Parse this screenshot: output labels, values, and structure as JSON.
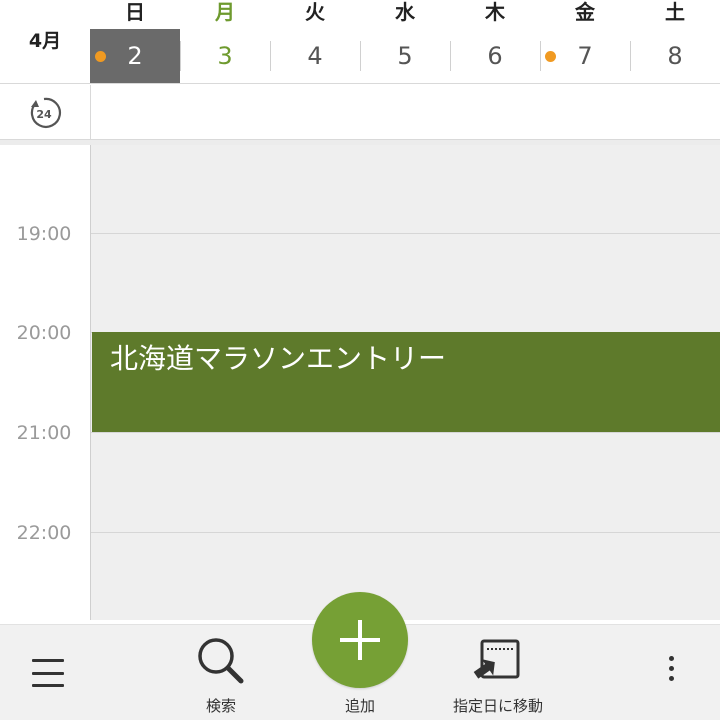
{
  "header": {
    "month": "4月",
    "weekdays": [
      "日",
      "月",
      "火",
      "水",
      "木",
      "金",
      "土"
    ],
    "dates": [
      "2",
      "3",
      "4",
      "5",
      "6",
      "7",
      "8"
    ],
    "selected_index": 0,
    "today_index": 1,
    "dot_indices": [
      0,
      5
    ]
  },
  "timeline": {
    "hours": [
      "19:00",
      "20:00",
      "21:00",
      "22:00"
    ]
  },
  "event": {
    "title": "北海道マラソンエントリー",
    "start": "20:00",
    "end": "21:00",
    "color": "#5e7a2b"
  },
  "toolbar": {
    "search_label": "検索",
    "add_label": "追加",
    "goto_label": "指定日に移動"
  },
  "icons": {
    "allday": "24-hour-icon",
    "menu": "menu-icon",
    "search": "search-icon",
    "add": "plus-icon",
    "goto": "go-to-date-icon",
    "more": "more-vertical-icon"
  },
  "colors": {
    "accent": "#76a035",
    "today_text": "#6e9a2e",
    "selected_bg": "#6a6a6a",
    "dot": "#f09a22"
  }
}
